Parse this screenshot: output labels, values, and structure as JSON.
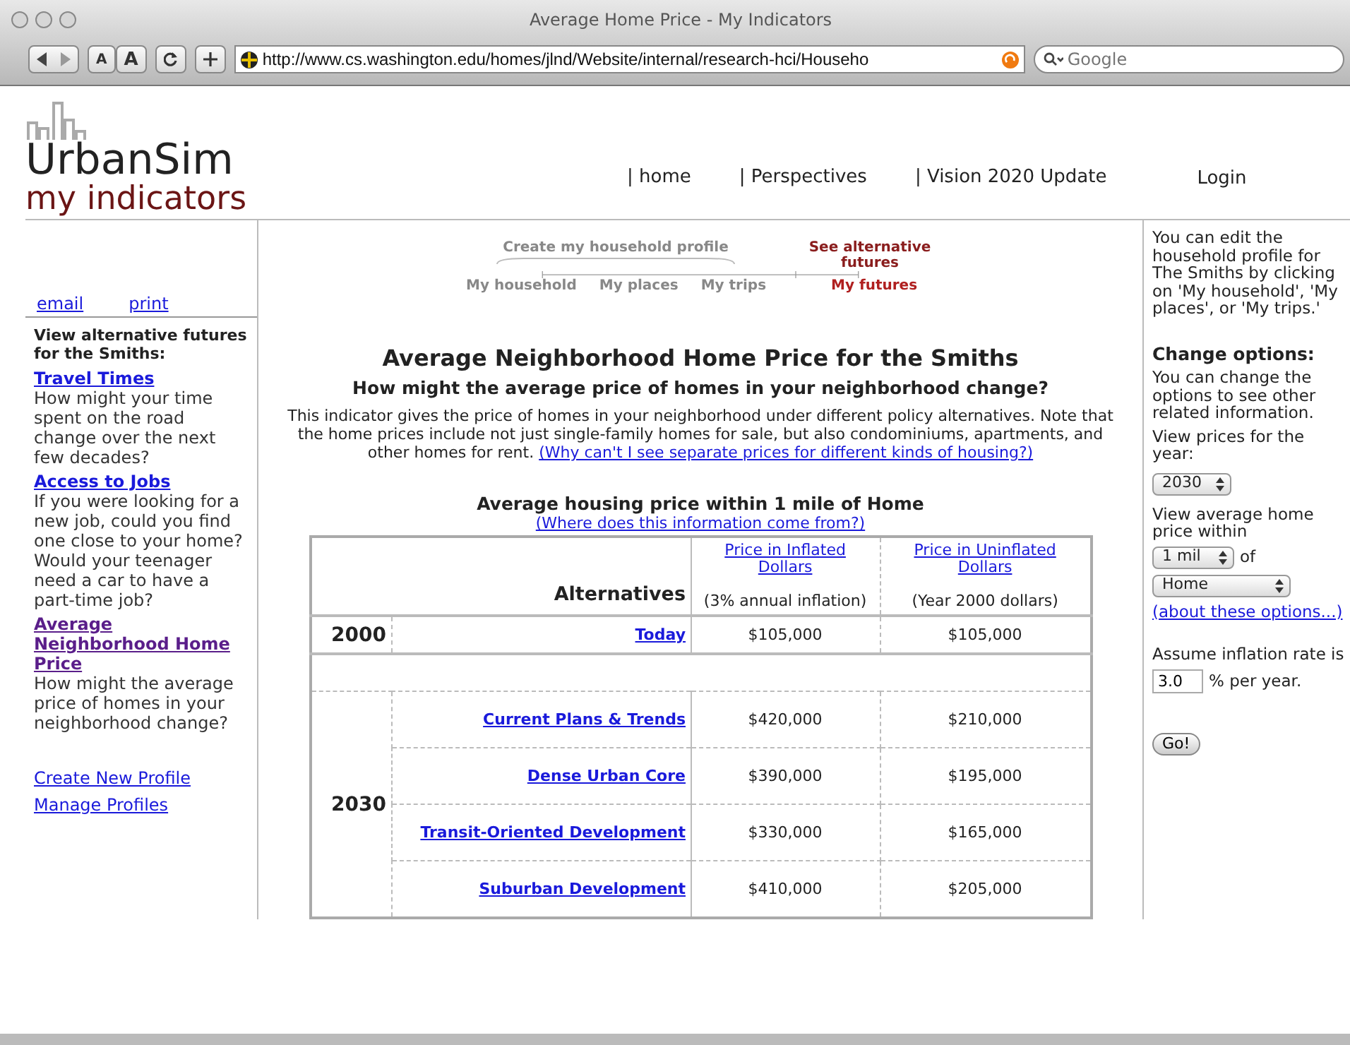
{
  "window": {
    "title": "Average Home Price - My Indicators"
  },
  "toolbar": {
    "text_size_buttons": [
      "A",
      "A"
    ],
    "url": "http://www.cs.washington.edu/homes/jlnd/Website/internal/research-hci/Househo",
    "search_placeholder": "Google"
  },
  "header": {
    "logo_title": "UrbanSim",
    "logo_subtitle": "my indicators",
    "nav": [
      "| home",
      "| Perspectives",
      "| Vision 2020 Update"
    ],
    "login": "Login"
  },
  "left_sidebar": {
    "links": [
      "email",
      "print"
    ],
    "heading": "View alternative futures for the Smiths:",
    "indicators": [
      {
        "title": "Travel Times",
        "description": "How might your time spent on the road change over the next few decades?",
        "selected": false
      },
      {
        "title": "Access to Jobs",
        "description": "If you were looking for a new job, could you find one close to your home? Would your teenager need a car to have a part-time job?",
        "selected": false
      },
      {
        "title": "Average Neighborhood Home Price",
        "description": "How might the average price of homes in your neighborhood change?",
        "selected": true
      }
    ],
    "profile_links": [
      "Create New Profile",
      "Manage Profiles"
    ]
  },
  "progress": {
    "profile_label": "Create my household profile",
    "futures_label": "See alternative futures",
    "steps": [
      {
        "label": "My household",
        "selected": false
      },
      {
        "label": "My places",
        "selected": false
      },
      {
        "label": "My trips",
        "selected": false
      },
      {
        "label": "My futures",
        "selected": true
      }
    ]
  },
  "main": {
    "title": "Average Neighborhood Home Price for the Smiths",
    "subtitle": "How might the average price of homes in your neighborhood change?",
    "description": "This indicator gives the price of homes in your neighborhood under different policy alternatives. Note that the home prices include not just single-family homes for sale, but also condominiums, apartments, and other homes for rent.",
    "description_link": "(Why can't I see separate prices for different kinds of housing?)",
    "table_caption": "Average housing price within 1 mile of Home",
    "source_link": "(Where does this information come from?)",
    "table": {
      "columns": [
        {
          "label": "Alternatives"
        },
        {
          "label": "Price in Inflated Dollars",
          "note": "(3% annual inflation)"
        },
        {
          "label": "Price in Uninflated Dollars",
          "note": "(Year 2000 dollars)"
        }
      ],
      "groups": [
        {
          "year": "2000",
          "rows": [
            {
              "alternative": "Today",
              "inflated": "$105,000",
              "uninflated": "$105,000"
            }
          ]
        },
        {
          "year": "2030",
          "rows": [
            {
              "alternative": "Current Plans & Trends",
              "inflated": "$420,000",
              "uninflated": "$210,000"
            },
            {
              "alternative": "Dense Urban Core",
              "inflated": "$390,000",
              "uninflated": "$195,000"
            },
            {
              "alternative": "Transit-Oriented Development",
              "inflated": "$330,000",
              "uninflated": "$165,000"
            },
            {
              "alternative": "Suburban Development",
              "inflated": "$410,000",
              "uninflated": "$205,000"
            }
          ]
        }
      ]
    }
  },
  "right_sidebar": {
    "intro": "You can edit the household profile for The Smiths by clicking on 'My household', 'My places', or 'My trips.'",
    "options_heading": "Change options:",
    "options_text": "You can change the options to see other related information.",
    "year_label": "View prices for the year:",
    "year_value": "2030",
    "radius_label": "View average home price within",
    "radius_value": "1 mil",
    "of_label": "of",
    "place_value": "Home",
    "about_link": "(about these options...)",
    "inflation_label": "Assume inflation rate is",
    "inflation_value": "3.0",
    "inflation_unit": "% per year.",
    "go_button": "Go!"
  }
}
